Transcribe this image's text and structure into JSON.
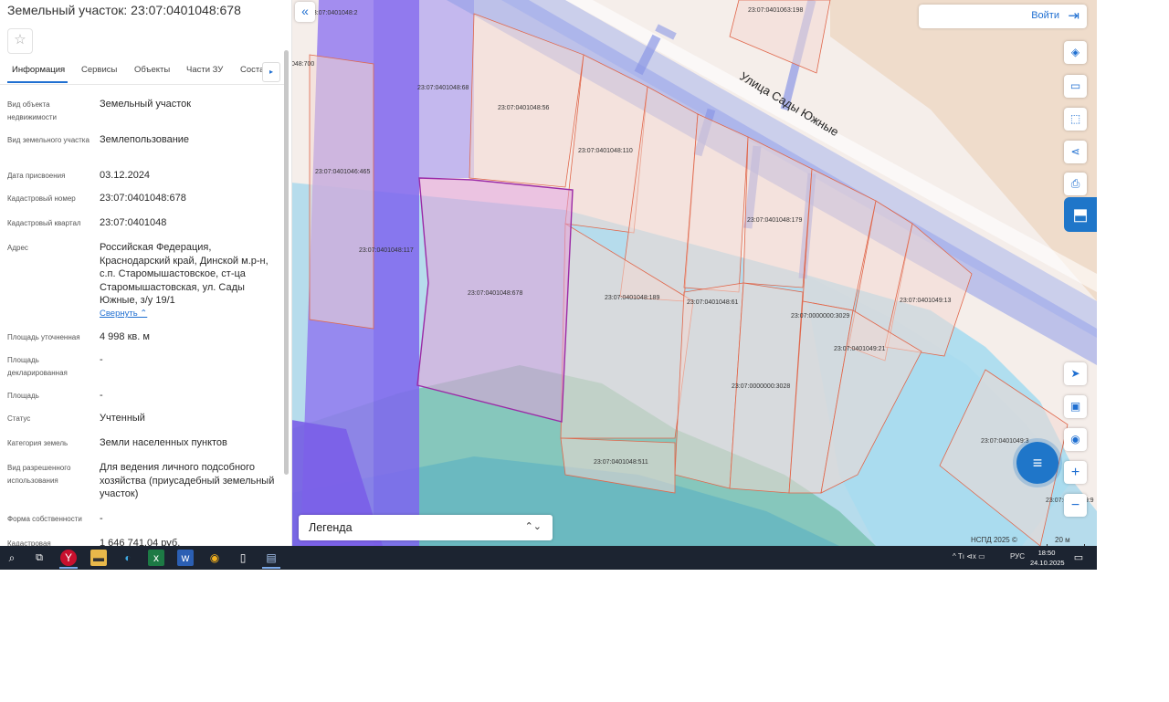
{
  "panel": {
    "title": "Земельный участок: 23:07:0401048:678",
    "star": "☆",
    "tabs": [
      "Информация",
      "Сервисы",
      "Объекты",
      "Части ЗУ",
      "Соста"
    ],
    "tab_arrow": "▸",
    "rows": [
      {
        "label": "Вид объекта недвижимости",
        "value": "Земельный участок"
      },
      {
        "label": "Вид земельного участка",
        "value": "Землепользование"
      },
      {
        "label": "Дата присвоения",
        "value": "03.12.2024"
      },
      {
        "label": "Кадастровый номер",
        "value": "23:07:0401048:678"
      },
      {
        "label": "Кадастровый квартал",
        "value": "23:07:0401048"
      },
      {
        "label": "Адрес",
        "value": "Российская Федерация, Краснодарский край, Динской м.р-н, с.п. Старомышастовское, ст-ца Старомышастовская, ул. Сады Южные, з/у 19/1"
      },
      {
        "label": "Площадь уточненная",
        "value": "4 998 кв. м"
      },
      {
        "label": "Площадь декларированная",
        "value": "-"
      },
      {
        "label": "Площадь",
        "value": "-"
      },
      {
        "label": "Статус",
        "value": "Учтенный"
      },
      {
        "label": "Категория земель",
        "value": "Земли населенных пунктов"
      },
      {
        "label": "Вид разрешенного использования",
        "value": "Для ведения личного подсобного хозяйства (приусадебный земельный участок)"
      },
      {
        "label": "Форма собственности",
        "value": "-"
      },
      {
        "label": "Кадастровая",
        "value": "1 646 741,04 руб."
      }
    ],
    "collapse_link": "Свернуть ⌃"
  },
  "map": {
    "collapse_button": "«",
    "login_label": "Войти",
    "login_icon": "⇥",
    "street": "Улица Сады Южные",
    "labels": {
      "p_2": "23:07:0401048:2",
      "p_198": "23:07:0401063:198",
      "p_700": "048:700",
      "p_68": "23:07:0401048:68",
      "p_56": "23:07:0401048:56",
      "p_110": "23:07:0401048:110",
      "p_465": "23:07:0401046:465",
      "p_179": "23:07:0401048:179",
      "p_117": "23:07:0401048:117",
      "p_678": "23:07:0401048:678",
      "p_189": "23:07:0401048:189",
      "p_61": "23:07:0401048:61",
      "p_13": "23:07:0401049:13",
      "p_3029": "23:07:0000000:3029",
      "p_21": "23:07:0401049:21",
      "p_3028": "23:07:0000000:3028",
      "p_511": "23:07:0401048:511",
      "p_3": "23:07:0401049:3",
      "p_9": "23:07:0401049:9"
    },
    "tools": [
      "layers-icon",
      "ruler-icon",
      "select-area-icon",
      "share-icon",
      "print-icon"
    ],
    "tool_glyphs": [
      "◈",
      "▭",
      "⬚",
      "⋖",
      "⎙"
    ],
    "active_tool_glyph": "⬒",
    "nav_glyphs": [
      "➤",
      "▣",
      "◉",
      "+",
      "−"
    ],
    "chat_glyph": "≡",
    "legend_label": "Легенда",
    "legend_arrow": "⌃⌄",
    "attribution": "НСПД 2025 ©",
    "scale": "20 м"
  },
  "taskbar": {
    "lang": "РУС",
    "time": "18:50",
    "date": "24.10.2025",
    "tray_icons": "^  Tı  ⊲x  ▭"
  },
  "colors": {
    "accent": "#1f6fd1",
    "selected_parcel": "#a032a8",
    "parcel_border": "#e0664a",
    "taskbar": "#1c2431"
  }
}
